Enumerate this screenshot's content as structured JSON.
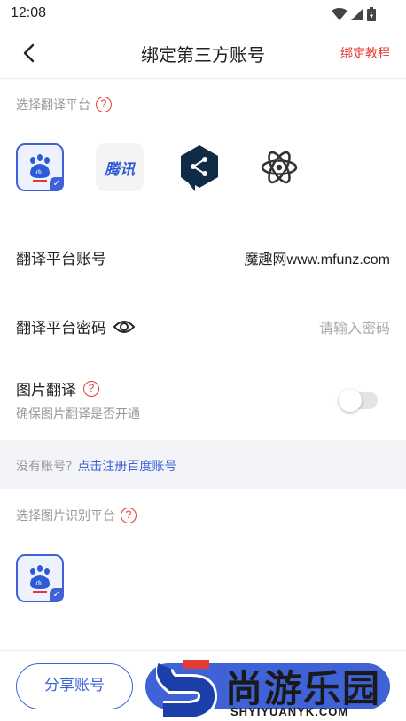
{
  "status_bar": {
    "time": "12:08"
  },
  "app_bar": {
    "title": "绑定第三方账号",
    "tutorial": "绑定教程"
  },
  "translate_platform": {
    "label": "选择翻译平台",
    "help": "?",
    "platforms": [
      {
        "name": "baidu",
        "selected": true
      },
      {
        "name": "tencent",
        "text": "腾讯",
        "selected": false
      },
      {
        "name": "deepl",
        "selected": false
      },
      {
        "name": "atom",
        "selected": false
      }
    ],
    "check": "✓"
  },
  "account": {
    "label": "翻译平台账号",
    "value": "魔趣网www.mfunz.com"
  },
  "password": {
    "label": "翻译平台密码",
    "placeholder": "请输入密码"
  },
  "image_translate": {
    "label": "图片翻译",
    "help": "?",
    "desc": "确保图片翻译是否开通",
    "enabled": false
  },
  "banner": {
    "text": "没有账号?",
    "link": "点击注册百度账号"
  },
  "ocr_platform": {
    "label": "选择图片识别平台",
    "help": "?",
    "check": "✓"
  },
  "bottom": {
    "share": "分享账号"
  },
  "watermark": {
    "main": "尚游乐园",
    "sub": "SHYIYUANYK.COM"
  },
  "colors": {
    "accent": "#3f62d7",
    "danger": "#e53935"
  }
}
